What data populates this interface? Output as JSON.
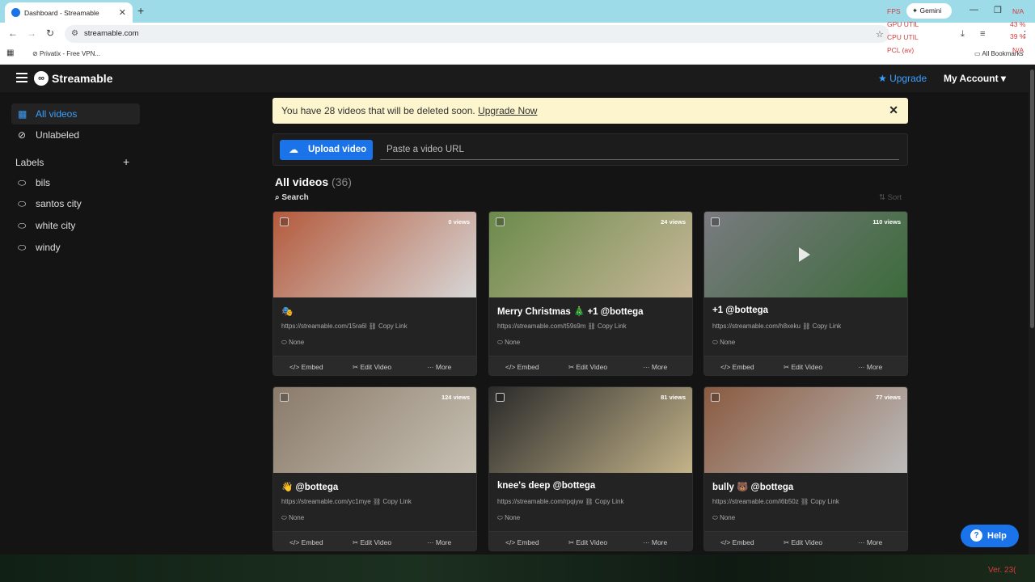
{
  "browser": {
    "tab_title": "Dashboard - Streamable",
    "url": "streamable.com",
    "gemini_label": "Gemini",
    "bookmark": "Privatix - Free VPN...",
    "all_bookmarks": "All Bookmarks",
    "overlay": {
      "fps": "FPS",
      "gpu": "GPU UTIL",
      "cpu": "CPU UTIL",
      "pcl": "PCL (av)",
      "fps_val": "N/A",
      "gpu_val": "43 %",
      "cpu_val": "39 %",
      "pcl_val": "N/A",
      "version": "Ver. 23("
    }
  },
  "header": {
    "logo": "Streamable",
    "upgrade": "Upgrade",
    "account": "My Account"
  },
  "sidebar": {
    "items": [
      {
        "label": "All videos"
      },
      {
        "label": "Unlabeled"
      }
    ],
    "labels_title": "Labels",
    "labels": [
      {
        "label": "bils"
      },
      {
        "label": "santos city"
      },
      {
        "label": "white city"
      },
      {
        "label": "windy"
      }
    ]
  },
  "banner": {
    "message": "You have 28 videos that will be deleted soon.",
    "link": "Upgrade Now"
  },
  "upload": {
    "button": "Upload video",
    "placeholder": "Paste a video URL"
  },
  "main": {
    "heading": "All videos",
    "count": "(36)",
    "search": "Search",
    "sort": "Sort"
  },
  "card_actions": {
    "embed": "Embed",
    "edit": "Edit Video",
    "more": "More",
    "copy": "Copy Link",
    "label": "None"
  },
  "videos": [
    {
      "title": "🎭",
      "views": "0 views",
      "link": "https://streamable.com/15ra6l",
      "colors": [
        "#b45a3c",
        "#d7d7d7"
      ]
    },
    {
      "title": "Merry Christmas 🎄 +1 @bottega",
      "views": "24 views",
      "link": "https://streamable.com/t59s9m",
      "colors": [
        "#6a8a4a",
        "#c9b89a"
      ]
    },
    {
      "title": "+1 @bottega",
      "views": "110 views",
      "link": "https://streamable.com/h8xeku",
      "colors": [
        "#7a7a80",
        "#3b6b3a"
      ]
    },
    {
      "title": "👋 @bottega",
      "views": "124 views",
      "link": "https://streamable.com/yc1mye",
      "colors": [
        "#8a7a6a",
        "#c8c2b4"
      ]
    },
    {
      "title": "knee's deep @bottega",
      "views": "81 views",
      "link": "https://streamable.com/rpqiyw",
      "colors": [
        "#2a2a2a",
        "#c4b48a"
      ]
    },
    {
      "title": "bully 🐻 @bottega",
      "views": "77 views",
      "link": "https://streamable.com/i6b50z",
      "colors": [
        "#8a5a40",
        "#bdbdbd"
      ]
    }
  ],
  "help": "Help"
}
